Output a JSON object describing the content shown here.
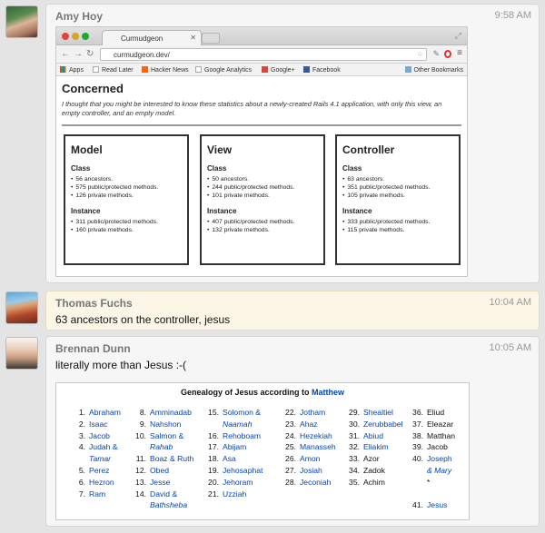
{
  "messages": [
    {
      "author": "Amy Hoy",
      "time": "9:58 AM"
    },
    {
      "author": "Thomas Fuchs",
      "time": "10:04 AM",
      "text": "63 ancestors on the controller, jesus"
    },
    {
      "author": "Brennan Dunn",
      "time": "10:05 AM",
      "text": "literally more than Jesus :-("
    }
  ],
  "screenshot": {
    "tab_title": "Curmudgeon",
    "url": "curmudgeon.dev/",
    "bookmarks": [
      "Apps",
      "Read Later",
      "Hacker News",
      "Google Analytics",
      "Google+",
      "Facebook",
      "Other Bookmarks"
    ],
    "heading": "Concerned",
    "intro": "I thought that you might be interested to know these statistics about a newly-created Rails 4.1 application, with only this view, an empty controller, and an empty model.",
    "boxes": [
      {
        "title": "Model",
        "class_label": "Class",
        "class_items": [
          "56 ancestors.",
          "575 public/protected methods.",
          "126 private methods."
        ],
        "instance_label": "Instance",
        "instance_items": [
          "311 public/protected methods.",
          "160 private methods."
        ]
      },
      {
        "title": "View",
        "class_label": "Class",
        "class_items": [
          "50 ancestors.",
          "244 public/protected methods.",
          "101 private methods."
        ],
        "instance_label": "Instance",
        "instance_items": [
          "407 public/protected methods.",
          "132 private methods."
        ]
      },
      {
        "title": "Controller",
        "class_label": "Class",
        "class_items": [
          "63 ancestors.",
          "351 public/protected methods.",
          "105 private methods."
        ],
        "instance_label": "Instance",
        "instance_items": [
          "333 public/protected methods.",
          "115 private methods."
        ]
      }
    ]
  },
  "genealogy": {
    "title_prefix": "Genealogy of Jesus according to",
    "title_link": "Matthew",
    "columns": [
      [
        [
          "1.",
          "Abraham"
        ],
        [
          "2.",
          "Isaac"
        ],
        [
          "3.",
          "Jacob"
        ],
        [
          "4.",
          "Judah &"
        ],
        [
          "",
          "Tamar"
        ],
        [
          "5.",
          "Perez"
        ],
        [
          "6.",
          "Hezron"
        ],
        [
          "7.",
          "Ram"
        ]
      ],
      [
        [
          "8.",
          "Amminadab"
        ],
        [
          "9.",
          "Nahshon"
        ],
        [
          "10.",
          "Salmon &"
        ],
        [
          "",
          "Rahab"
        ],
        [
          "11.",
          "Boaz & Ruth"
        ],
        [
          "12.",
          "Obed"
        ],
        [
          "13.",
          "Jesse"
        ],
        [
          "14.",
          "David &"
        ],
        [
          "",
          "Bathsheba"
        ]
      ],
      [
        [
          "15.",
          "Solomon &"
        ],
        [
          "",
          "Naamah"
        ],
        [
          "16.",
          "Rehoboam"
        ],
        [
          "17.",
          "Abijam"
        ],
        [
          "18.",
          "Asa"
        ],
        [
          "19.",
          "Jehosaphat"
        ],
        [
          "20.",
          "Jehoram"
        ],
        [
          "21.",
          "Uzziah"
        ]
      ],
      [
        [
          "22.",
          "Jotham"
        ],
        [
          "23.",
          "Ahaz"
        ],
        [
          "24.",
          "Hezekiah"
        ],
        [
          "25.",
          "Manasseh"
        ],
        [
          "26.",
          "Amon"
        ],
        [
          "27.",
          "Josiah"
        ],
        [
          "28.",
          "Jeconiah"
        ]
      ],
      [
        [
          "29.",
          "Shealtiel"
        ],
        [
          "30.",
          "Zerubbabel"
        ],
        [
          "31.",
          "Abiud"
        ],
        [
          "32.",
          "Eliakim"
        ],
        [
          "33.",
          "Azor"
        ],
        [
          "34.",
          "Zadok"
        ],
        [
          "35.",
          "Achim"
        ]
      ],
      [
        [
          "36.",
          "Eliud"
        ],
        [
          "37.",
          "Eleazar"
        ],
        [
          "38.",
          "Matthan"
        ],
        [
          "39.",
          "Jacob"
        ],
        [
          "40.",
          "Joseph"
        ],
        [
          "",
          "& Mary"
        ],
        [
          "",
          "*"
        ],
        [
          "",
          ""
        ],
        [
          "41.",
          "Jesus"
        ]
      ]
    ]
  }
}
